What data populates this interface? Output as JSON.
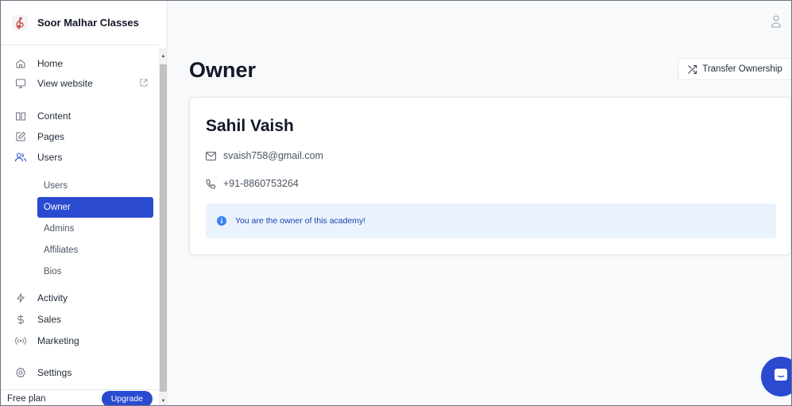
{
  "brand": {
    "name": "Soor Malhar Classes",
    "logo_icon": "treble-clef-icon"
  },
  "sidebar": {
    "items": [
      {
        "label": "Home",
        "icon": "home-icon"
      },
      {
        "label": "View website",
        "icon": "monitor-icon"
      },
      {
        "label": "Content",
        "icon": "book-icon"
      },
      {
        "label": "Pages",
        "icon": "edit-icon"
      },
      {
        "label": "Users",
        "icon": "users-icon"
      },
      {
        "label": "Activity",
        "icon": "lightning-icon"
      },
      {
        "label": "Sales",
        "icon": "dollar-icon"
      },
      {
        "label": "Marketing",
        "icon": "broadcast-icon"
      },
      {
        "label": "Settings",
        "icon": "gear-icon"
      }
    ],
    "users_submenu": [
      {
        "label": "Users"
      },
      {
        "label": "Owner",
        "active": true
      },
      {
        "label": "Admins"
      },
      {
        "label": "Affiliates"
      },
      {
        "label": "Bios"
      }
    ],
    "footer": {
      "plan_label": "Free plan",
      "upgrade_label": "Upgrade"
    }
  },
  "main": {
    "title": "Owner",
    "transfer_button_label": "Transfer Ownership",
    "owner": {
      "name": "Sahil Vaish",
      "email": "svaish758@gmail.com",
      "phone": "+91-8860753264"
    },
    "info_message": "You are the owner of this academy!"
  },
  "colors": {
    "accent": "#2a4bd0",
    "info_bg": "#eaf3fd",
    "info_text": "#1e40af"
  }
}
